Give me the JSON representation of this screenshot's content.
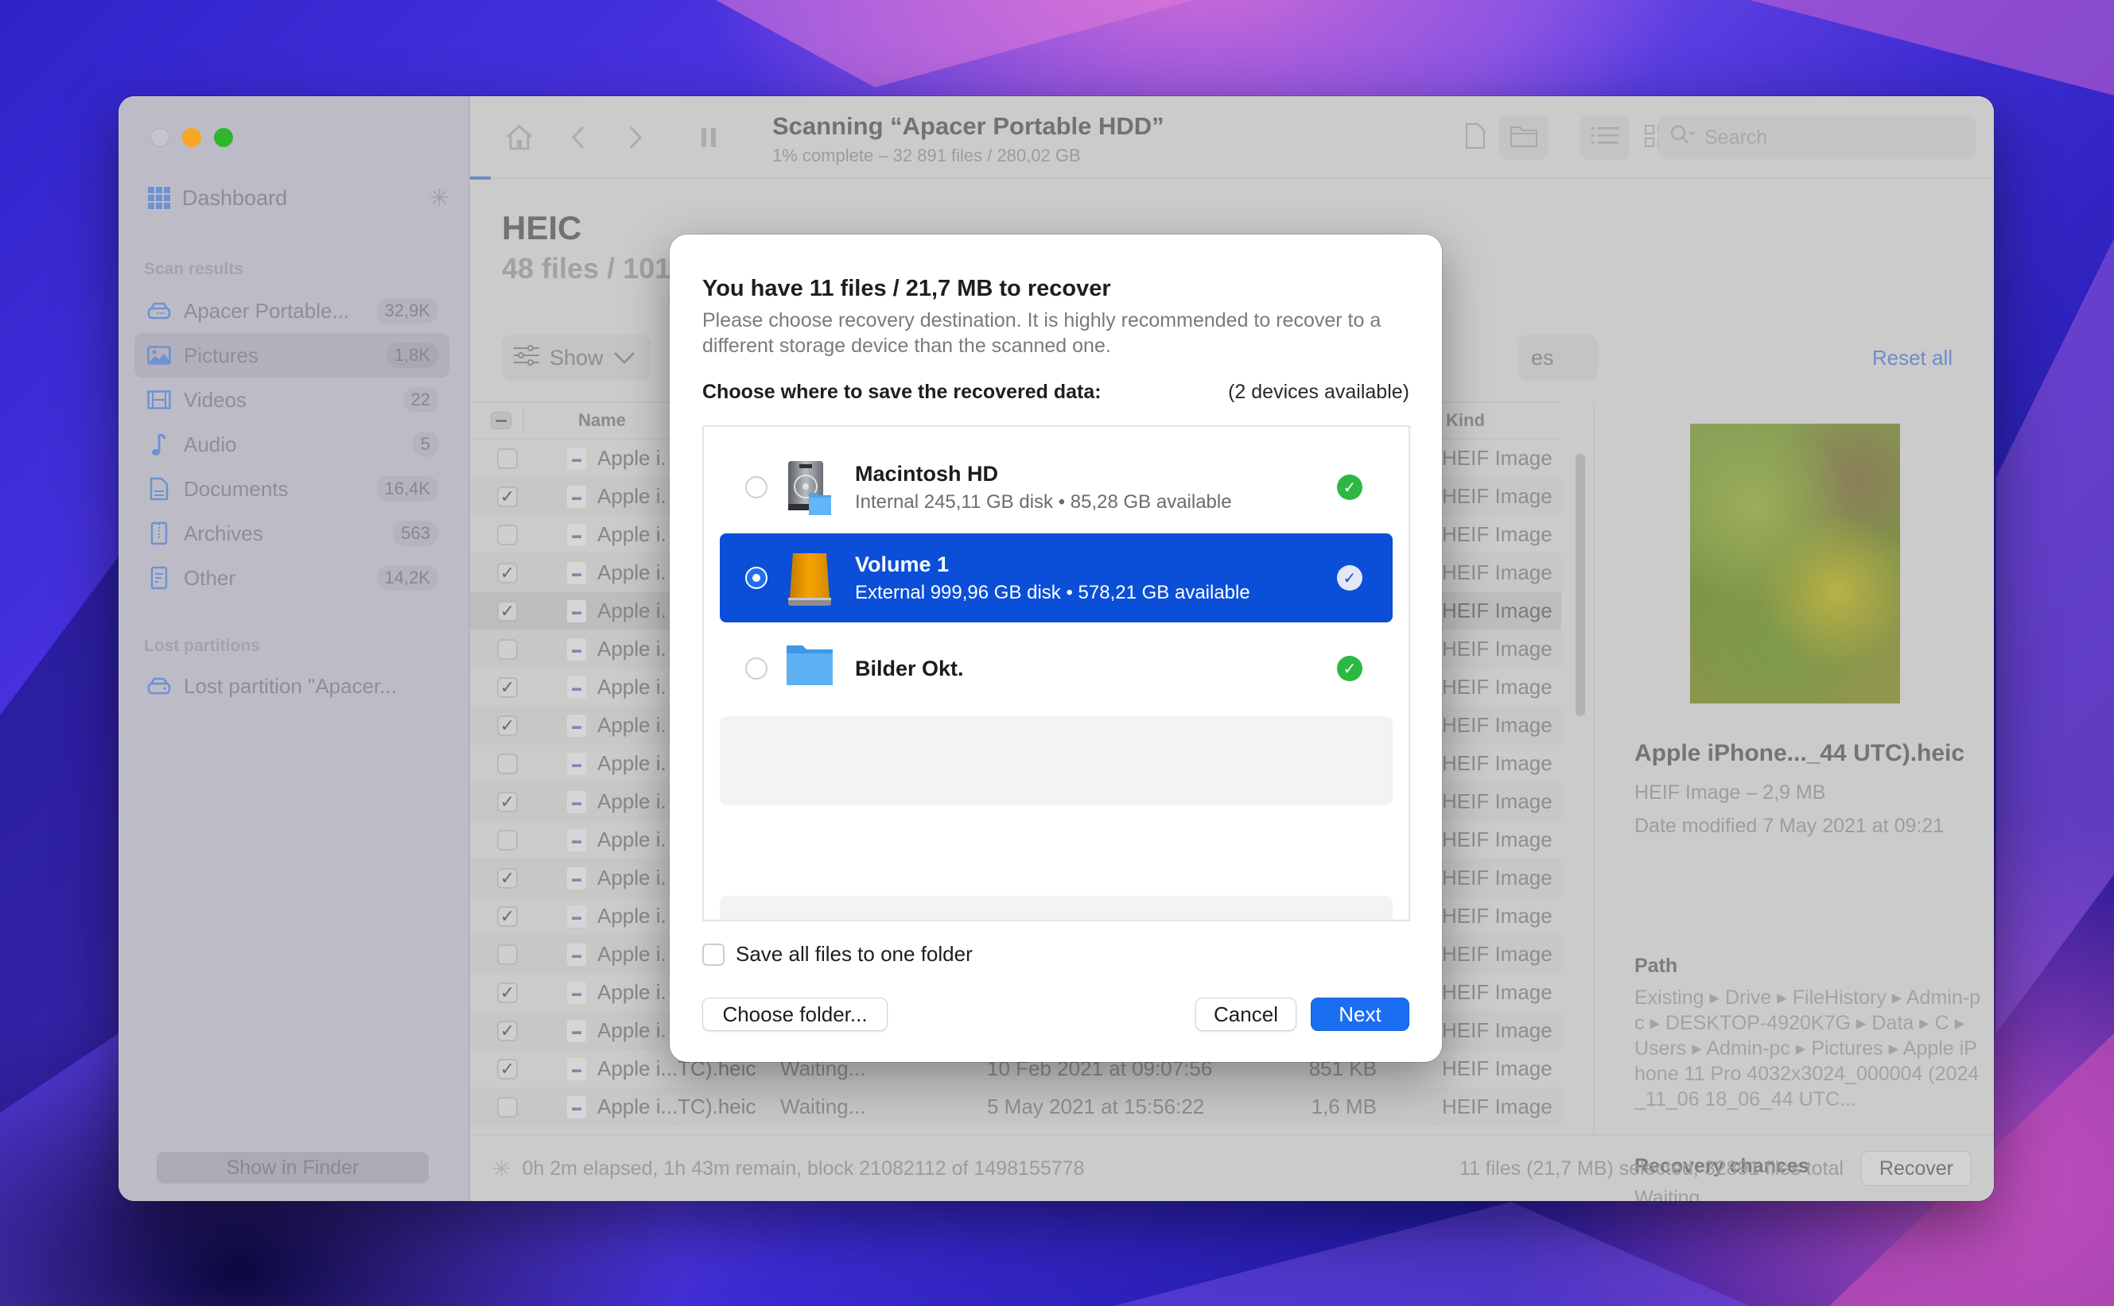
{
  "window": {
    "traffic_lights": [
      "close",
      "minimize",
      "maximize"
    ]
  },
  "sidebar": {
    "dashboard_label": "Dashboard",
    "scan_results_heading": "Scan results",
    "items": [
      {
        "label": "Apacer Portable...",
        "count": "32,9K",
        "icon": "drive-icon",
        "active": false
      },
      {
        "label": "Pictures",
        "count": "1,8K",
        "icon": "picture-icon",
        "active": true
      },
      {
        "label": "Videos",
        "count": "22",
        "icon": "film-icon",
        "active": false
      },
      {
        "label": "Audio",
        "count": "5",
        "icon": "music-note-icon",
        "active": false
      },
      {
        "label": "Documents",
        "count": "16,4K",
        "icon": "document-icon",
        "active": false
      },
      {
        "label": "Archives",
        "count": "563",
        "icon": "archive-icon",
        "active": false
      },
      {
        "label": "Other",
        "count": "14,2K",
        "icon": "other-file-icon",
        "active": false
      }
    ],
    "lost_partitions_heading": "Lost partitions",
    "lost_partitions": [
      {
        "label": "Lost partition \"Apacer...",
        "icon": "drive-icon"
      }
    ],
    "show_in_finder_label": "Show in Finder"
  },
  "toolbar": {
    "scan_title": "Scanning “Apacer Portable HDD”",
    "scan_subtitle": "1% complete – 32 891 files / 280,02 GB",
    "search_placeholder": "Search",
    "progress_percent": 1
  },
  "content": {
    "heading": "HEIC",
    "subheading": "48 files / 101,",
    "show_label": "Show",
    "filter_partial": "es",
    "reset_all_label": "Reset all",
    "columns": {
      "name": "Name",
      "kind": "Kind"
    },
    "rows": [
      {
        "checked": false,
        "name": "Apple i.",
        "status": "",
        "date": "",
        "size": "",
        "kind": "HEIF Image"
      },
      {
        "checked": true,
        "name": "Apple i.",
        "status": "",
        "date": "",
        "size": "",
        "kind": "HEIF Image"
      },
      {
        "checked": false,
        "name": "Apple i.",
        "status": "",
        "date": "",
        "size": "",
        "kind": "HEIF Image"
      },
      {
        "checked": true,
        "name": "Apple i.",
        "status": "",
        "date": "",
        "size": "",
        "kind": "HEIF Image"
      },
      {
        "checked": true,
        "name": "Apple i.",
        "status": "",
        "date": "",
        "size": "",
        "kind": "HEIF Image",
        "selected": true
      },
      {
        "checked": false,
        "name": "Apple i.",
        "status": "",
        "date": "",
        "size": "",
        "kind": "HEIF Image"
      },
      {
        "checked": true,
        "name": "Apple i.",
        "status": "",
        "date": "",
        "size": "",
        "kind": "HEIF Image"
      },
      {
        "checked": true,
        "name": "Apple i.",
        "status": "",
        "date": "",
        "size": "",
        "kind": "HEIF Image"
      },
      {
        "checked": false,
        "name": "Apple i.",
        "status": "",
        "date": "",
        "size": "",
        "kind": "HEIF Image"
      },
      {
        "checked": true,
        "name": "Apple i.",
        "status": "",
        "date": "",
        "size": "",
        "kind": "HEIF Image"
      },
      {
        "checked": false,
        "name": "Apple i.",
        "status": "",
        "date": "",
        "size": "",
        "kind": "HEIF Image"
      },
      {
        "checked": true,
        "name": "Apple i.",
        "status": "",
        "date": "",
        "size": "",
        "kind": "HEIF Image"
      },
      {
        "checked": true,
        "name": "Apple i.",
        "status": "",
        "date": "",
        "size": "",
        "kind": "HEIF Image"
      },
      {
        "checked": false,
        "name": "Apple i.",
        "status": "",
        "date": "",
        "size": "",
        "kind": "HEIF Image"
      },
      {
        "checked": true,
        "name": "Apple i.",
        "status": "",
        "date": "",
        "size": "",
        "kind": "HEIF Image"
      },
      {
        "checked": true,
        "name": "Apple i.",
        "status": "",
        "date": "",
        "size": "",
        "kind": "HEIF Image"
      },
      {
        "checked": true,
        "name": "Apple i...TC).heic",
        "status": "Waiting...",
        "date": "10 Feb 2021 at 09:07:56",
        "size": "851 KB",
        "kind": "HEIF Image"
      },
      {
        "checked": false,
        "name": "Apple i...TC).heic",
        "status": "Waiting...",
        "date": "5 May 2021 at 15:56:22",
        "size": "1,6 MB",
        "kind": "HEIF Image"
      }
    ]
  },
  "details": {
    "file_name": "Apple iPhone..._44 UTC).heic",
    "file_type": "HEIF Image – 2,9 MB",
    "date_modified": "Date modified 7 May 2021 at 09:21",
    "path_label": "Path",
    "path": "Existing ▸ Drive ▸ FileHistory ▸ Admin-pc ▸ DESKTOP-4920K7G ▸ Data ▸ C ▸ Users ▸ Admin-pc ▸ Pictures ▸ Apple iPhone 11 Pro 4032x3024_000004 (2024_11_06 18_06_44 UTC...",
    "recovery_label": "Recovery chances",
    "recovery_value": "Waiting..."
  },
  "statusbar": {
    "progress_text": "0h 2m elapsed, 1h 43m remain, block 21082112 of 1498155778",
    "selection_text": "11 files (21,7 MB) selected, 32891 files total",
    "recover_label": "Recover"
  },
  "dialog": {
    "title": "You have 11 files / 21,7 MB to recover",
    "description": "Please choose recovery destination. It is highly recommended to recover to a different storage device than the scanned one.",
    "choose_label": "Choose where to save the recovered data:",
    "devices_available": "(2 devices available)",
    "destinations": [
      {
        "name": "Macintosh HD",
        "detail": "Internal 245,11 GB disk • 85,28 GB available",
        "icon": "internal-disk-icon",
        "selected": false,
        "status": "ok"
      },
      {
        "name": "Volume 1",
        "detail": "External 999,96 GB disk • 578,21 GB available",
        "icon": "external-disk-icon",
        "selected": true,
        "status": "ok"
      },
      {
        "name": "Bilder Okt.",
        "detail": "",
        "icon": "folder-icon",
        "selected": false,
        "status": "ok"
      }
    ],
    "save_one_folder_label": "Save all files to one folder",
    "save_one_folder_checked": false,
    "choose_folder_label": "Choose folder...",
    "cancel_label": "Cancel",
    "next_label": "Next",
    "colors": {
      "accent": "#0b4fd8",
      "primary_button": "#1a6ef2",
      "ok_check": "#2db843"
    }
  }
}
